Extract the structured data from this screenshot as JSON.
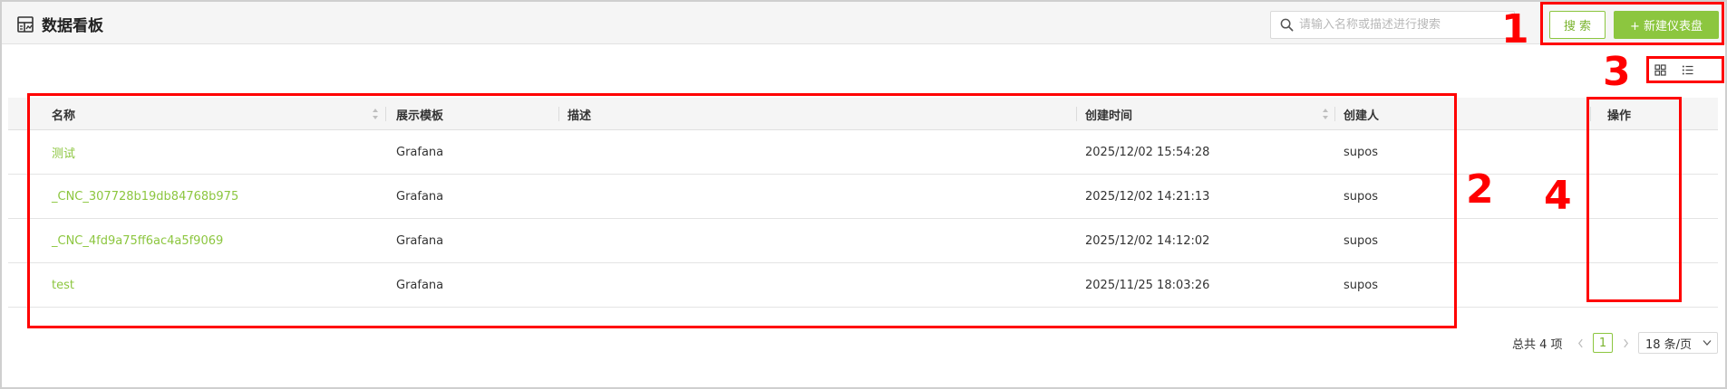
{
  "header": {
    "title": "数据看板",
    "title_icon": "dashboard-icon",
    "search_placeholder": "请输入名称或描述进行搜索",
    "search_value": "",
    "search_button": "搜 索",
    "new_button": "+ 新建仪表盘"
  },
  "view_toggle": {
    "grid_icon": "grid-view-icon",
    "list_icon": "list-view-icon"
  },
  "table": {
    "columns": {
      "name": "名称",
      "template": "展示模板",
      "description": "描述",
      "created_at": "创建时间",
      "creator": "创建人",
      "actions": "操作"
    },
    "rows": [
      {
        "name": "测试",
        "template": "Grafana",
        "description": "",
        "created_at": "2025/12/02 15:54:28",
        "creator": "supos"
      },
      {
        "name": "_CNC_307728b19db84768b975",
        "template": "Grafana",
        "description": "",
        "created_at": "2025/12/02 14:21:13",
        "creator": "supos"
      },
      {
        "name": "_CNC_4fd9a75ff6ac4a5f9069",
        "template": "Grafana",
        "description": "",
        "created_at": "2025/12/02 14:12:02",
        "creator": "supos"
      },
      {
        "name": "test",
        "template": "Grafana",
        "description": "",
        "created_at": "2025/11/25 18:03:26",
        "creator": "supos"
      }
    ]
  },
  "pagination": {
    "total": "总共 4 项",
    "current_page": "1",
    "page_size": "18 条/页"
  },
  "annotations": [
    "1",
    "2",
    "3",
    "4"
  ],
  "colors": {
    "accent": "#8cc63f",
    "annotation": "#ff0000"
  }
}
